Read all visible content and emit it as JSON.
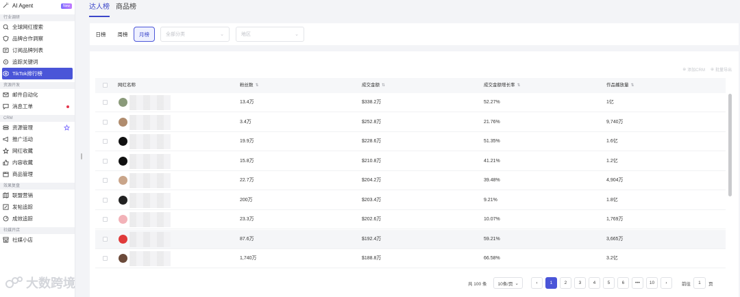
{
  "sidebar": {
    "top_item": {
      "label": "AI Agent",
      "badge": "New"
    },
    "sections": [
      {
        "title": "行业调研",
        "items": [
          "全球网红搜索",
          "品牌合作洞察",
          "订阅品牌列表",
          "追踪关键词",
          "TikTok排行榜"
        ]
      },
      {
        "title": "资源开发",
        "items": [
          "邮件自动化",
          "消息工单"
        ]
      },
      {
        "title": "CRM",
        "items": [
          "资源管理",
          "推广活动",
          "网红收藏",
          "内容收藏",
          "商品管理"
        ]
      },
      {
        "title": "效果复盘",
        "items": [
          "联盟营销",
          "发帖追踪",
          "成效追踪"
        ]
      },
      {
        "title": "社媒开店",
        "items": [
          "社媒小店"
        ]
      }
    ],
    "active_item": "TikTok排行榜"
  },
  "tabs": [
    "达人榜",
    "商品榜"
  ],
  "filters": {
    "period": [
      "日榜",
      "周榜",
      "月榜"
    ],
    "active_period": "月榜",
    "category_placeholder": "全部分类",
    "region_placeholder": "地区"
  },
  "table": {
    "actions": [
      "添加CRM",
      "批量导出"
    ],
    "columns": [
      "网红名称",
      "粉丝数",
      "成交金额",
      "成交金额增长率",
      "作品播放量"
    ],
    "rows": [
      {
        "fans": "13.4万",
        "gmv": "$338.2万",
        "growth": "52.27%",
        "views": "1亿"
      },
      {
        "fans": "3.4万",
        "gmv": "$252.8万",
        "growth": "21.76%",
        "views": "9,740万"
      },
      {
        "fans": "19.9万",
        "gmv": "$228.6万",
        "growth": "51.35%",
        "views": "1.6亿"
      },
      {
        "fans": "15.8万",
        "gmv": "$210.8万",
        "growth": "41.21%",
        "views": "1.2亿"
      },
      {
        "fans": "22.7万",
        "gmv": "$204.2万",
        "growth": "39.48%",
        "views": "4,904万"
      },
      {
        "fans": "200万",
        "gmv": "$203.4万",
        "growth": "9.21%",
        "views": "1.8亿"
      },
      {
        "fans": "23.3万",
        "gmv": "$202.6万",
        "growth": "10.07%",
        "views": "1,769万"
      },
      {
        "fans": "87.6万",
        "gmv": "$192.4万",
        "growth": "59.21%",
        "views": "3,665万"
      },
      {
        "fans": "1,740万",
        "gmv": "$188.8万",
        "growth": "66.58%",
        "views": "3.2亿"
      }
    ]
  },
  "pagination": {
    "total": "共 100 条",
    "page_size": "10条/页",
    "pages": [
      "1",
      "2",
      "3",
      "4",
      "5",
      "6",
      "•••",
      "10"
    ],
    "active_page": "1",
    "goto_label": "前往",
    "goto_value": "1",
    "goto_suffix": "页"
  },
  "watermark": "大数跨境",
  "colors": {
    "accent": "#4a55d8",
    "badge_gradient": "#7b6cff",
    "notify_dot": "#e5364c"
  }
}
